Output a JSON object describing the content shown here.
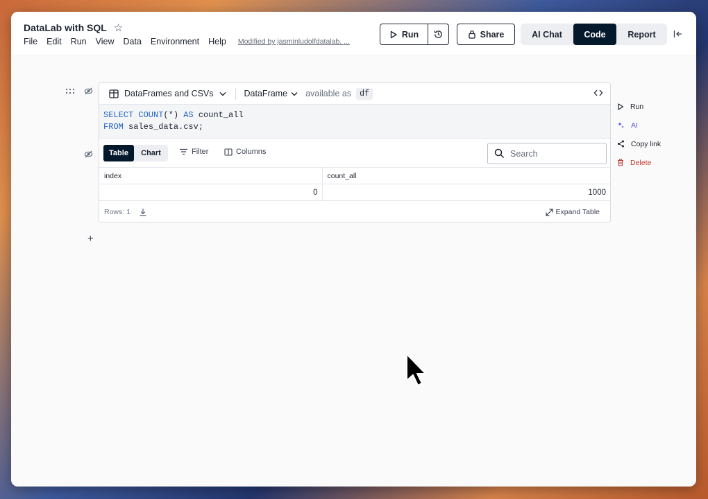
{
  "header": {
    "title": "DataLab with SQL",
    "menu": [
      "File",
      "Edit",
      "Run",
      "View",
      "Data",
      "Environment",
      "Help"
    ],
    "modified": "Modified by jasminludolfdatalab, ...",
    "run_label": "Run",
    "share_label": "Share",
    "modes": [
      "AI Chat",
      "Code",
      "Report"
    ],
    "active_mode": "Code"
  },
  "cell": {
    "source_label": "DataFrames and CSVs",
    "output_type": "DataFrame",
    "available_as": "available as",
    "df_name": "df",
    "code_lines": [
      {
        "kw1": "SELECT COUNT",
        "mid": "(*) ",
        "kw2": "AS",
        "rest": " count_all"
      },
      {
        "kw1": "FROM",
        "mid": " sales_data.csv;",
        "kw2": "",
        "rest": ""
      }
    ],
    "view_tabs": [
      "Table",
      "Chart"
    ],
    "active_view": "Table",
    "filter_label": "Filter",
    "columns_label": "Columns",
    "search_placeholder": "Search",
    "table": {
      "columns": [
        "index",
        "count_all"
      ],
      "rows": [
        [
          "0",
          "1000"
        ]
      ]
    },
    "rows_count": "Rows: 1",
    "expand_label": "Expand Table"
  },
  "side_actions": {
    "run": "Run",
    "ai": "AI",
    "copy_link": "Copy link",
    "delete": "Delete"
  },
  "colors": {
    "accent_dark": "#05192d",
    "sql_keyword": "#1f63c6",
    "ai_purple": "#5d55d6",
    "delete_red": "#c0392b"
  }
}
